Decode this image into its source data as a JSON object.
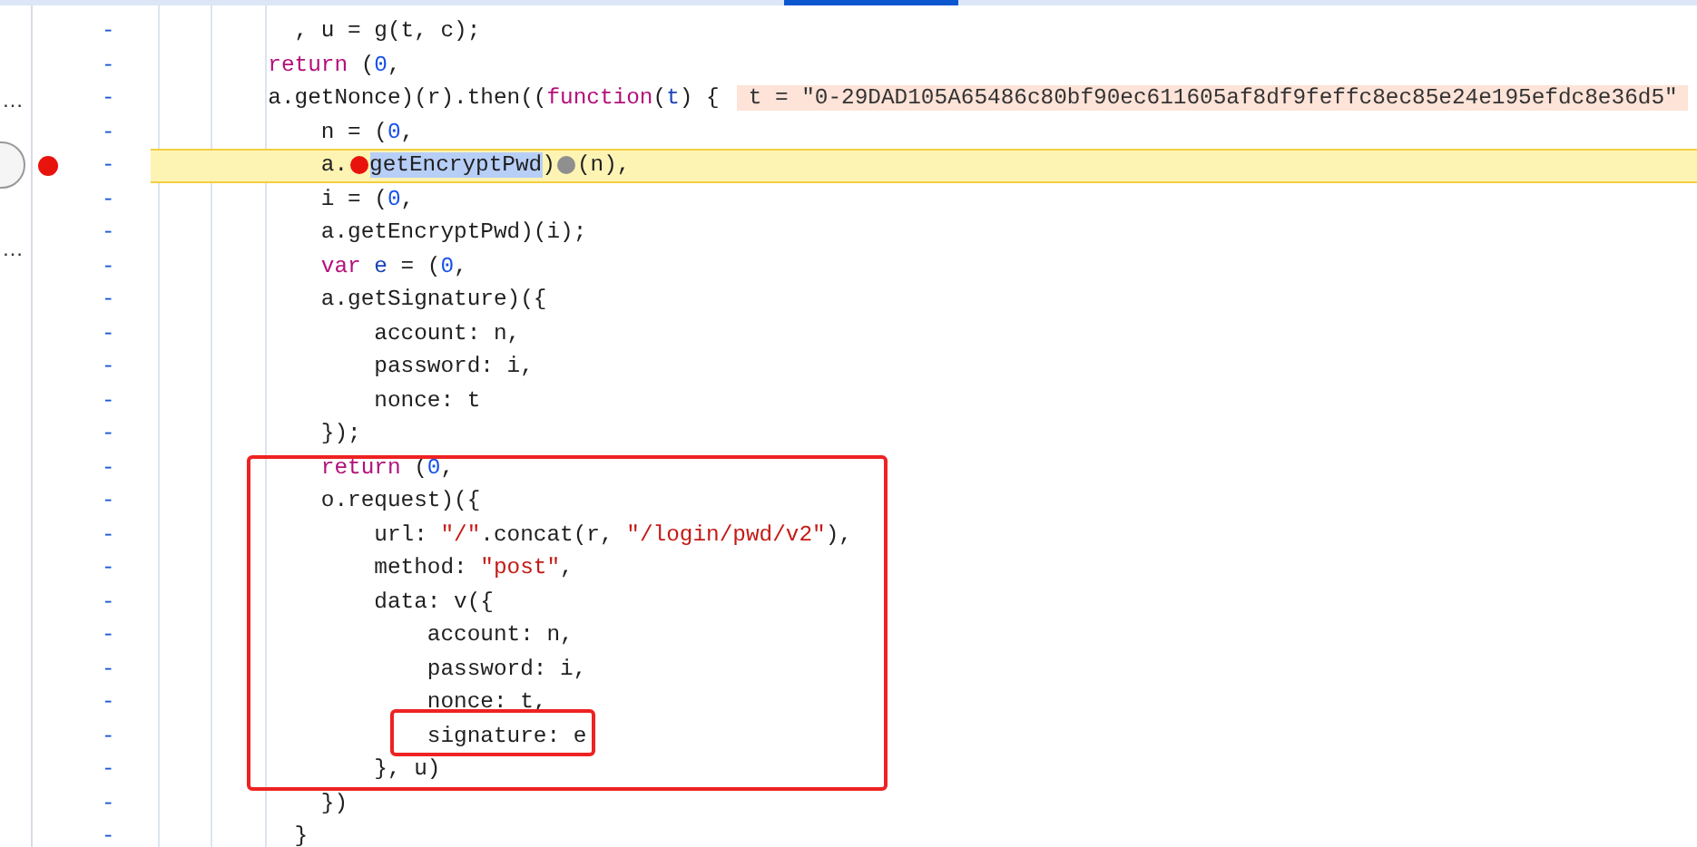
{
  "sidebar": {
    "items": [
      "…",
      "…"
    ]
  },
  "lines": [
    {
      "line_number": "-",
      "breakpoint": false,
      "highlighted": false,
      "tokens": [
        {
          "kind": "plain",
          "text": "    , u = g(t, c);"
        }
      ]
    },
    {
      "line_number": "-",
      "breakpoint": false,
      "highlighted": false,
      "tokens": [
        {
          "kind": "keyword",
          "text": "  return"
        },
        {
          "kind": "plain",
          "text": " ("
        },
        {
          "kind": "number",
          "text": "0"
        },
        {
          "kind": "plain",
          "text": ","
        }
      ]
    },
    {
      "line_number": "-",
      "breakpoint": false,
      "highlighted": false,
      "tokens": [
        {
          "kind": "plain",
          "text": "  a.getNonce)(r).then(("
        },
        {
          "kind": "keyword",
          "text": "function"
        },
        {
          "kind": "plain",
          "text": "("
        },
        {
          "kind": "variable",
          "text": "t"
        },
        {
          "kind": "plain",
          "text": ") {"
        }
      ],
      "inline_value": "t = \"0-29DAD105A65486c80bf90ec611605af8df9feffc8ec85e24e195efdc8e36d5\""
    },
    {
      "line_number": "-",
      "breakpoint": false,
      "highlighted": false,
      "tokens": [
        {
          "kind": "plain",
          "text": "      n = ("
        },
        {
          "kind": "number",
          "text": "0"
        },
        {
          "kind": "plain",
          "text": ","
        }
      ]
    },
    {
      "line_number": "-",
      "breakpoint": true,
      "highlighted": true,
      "tokens": [
        {
          "kind": "plain",
          "text": "      a."
        },
        {
          "kind": "stop"
        },
        {
          "kind": "selected",
          "text": "getEncryptPwd"
        },
        {
          "kind": "plain",
          "text": ")"
        },
        {
          "kind": "pause"
        },
        {
          "kind": "plain",
          "text": "(n),"
        }
      ]
    },
    {
      "line_number": "-",
      "breakpoint": false,
      "highlighted": false,
      "tokens": [
        {
          "kind": "plain",
          "text": "      i = ("
        },
        {
          "kind": "number",
          "text": "0"
        },
        {
          "kind": "plain",
          "text": ","
        }
      ]
    },
    {
      "line_number": "-",
      "breakpoint": false,
      "highlighted": false,
      "tokens": [
        {
          "kind": "plain",
          "text": "      a.getEncryptPwd)(i);"
        }
      ]
    },
    {
      "line_number": "-",
      "breakpoint": false,
      "highlighted": false,
      "tokens": [
        {
          "kind": "keyword",
          "text": "      var "
        },
        {
          "kind": "variable",
          "text": "e"
        },
        {
          "kind": "plain",
          "text": " = ("
        },
        {
          "kind": "number",
          "text": "0"
        },
        {
          "kind": "plain",
          "text": ","
        }
      ]
    },
    {
      "line_number": "-",
      "breakpoint": false,
      "highlighted": false,
      "tokens": [
        {
          "kind": "plain",
          "text": "      a.getSignature)({"
        }
      ]
    },
    {
      "line_number": "-",
      "breakpoint": false,
      "highlighted": false,
      "tokens": [
        {
          "kind": "plain",
          "text": "          account: n,"
        }
      ]
    },
    {
      "line_number": "-",
      "breakpoint": false,
      "highlighted": false,
      "tokens": [
        {
          "kind": "plain",
          "text": "          password: i,"
        }
      ]
    },
    {
      "line_number": "-",
      "breakpoint": false,
      "highlighted": false,
      "tokens": [
        {
          "kind": "plain",
          "text": "          nonce: t"
        }
      ]
    },
    {
      "line_number": "-",
      "breakpoint": false,
      "highlighted": false,
      "tokens": [
        {
          "kind": "plain",
          "text": "      });"
        }
      ]
    },
    {
      "line_number": "-",
      "breakpoint": false,
      "highlighted": false,
      "tokens": [
        {
          "kind": "keyword",
          "text": "      return"
        },
        {
          "kind": "plain",
          "text": " ("
        },
        {
          "kind": "number",
          "text": "0"
        },
        {
          "kind": "plain",
          "text": ","
        }
      ]
    },
    {
      "line_number": "-",
      "breakpoint": false,
      "highlighted": false,
      "tokens": [
        {
          "kind": "plain",
          "text": "      o.request)({"
        }
      ]
    },
    {
      "line_number": "-",
      "breakpoint": false,
      "highlighted": false,
      "tokens": [
        {
          "kind": "plain",
          "text": "          url: "
        },
        {
          "kind": "string",
          "text": "\"/\""
        },
        {
          "kind": "plain",
          "text": ".concat(r, "
        },
        {
          "kind": "string",
          "text": "\"/login/pwd/v2\""
        },
        {
          "kind": "plain",
          "text": "),"
        }
      ]
    },
    {
      "line_number": "-",
      "breakpoint": false,
      "highlighted": false,
      "tokens": [
        {
          "kind": "plain",
          "text": "          method: "
        },
        {
          "kind": "string",
          "text": "\"post\""
        },
        {
          "kind": "plain",
          "text": ","
        }
      ]
    },
    {
      "line_number": "-",
      "breakpoint": false,
      "highlighted": false,
      "tokens": [
        {
          "kind": "plain",
          "text": "          data: v({"
        }
      ]
    },
    {
      "line_number": "-",
      "breakpoint": false,
      "highlighted": false,
      "tokens": [
        {
          "kind": "plain",
          "text": "              account: n,"
        }
      ]
    },
    {
      "line_number": "-",
      "breakpoint": false,
      "highlighted": false,
      "tokens": [
        {
          "kind": "plain",
          "text": "              password: i,"
        }
      ]
    },
    {
      "line_number": "-",
      "breakpoint": false,
      "highlighted": false,
      "tokens": [
        {
          "kind": "plain",
          "text": "              nonce: t,"
        }
      ]
    },
    {
      "line_number": "-",
      "breakpoint": false,
      "highlighted": false,
      "tokens": [
        {
          "kind": "plain",
          "text": "              signature: e"
        }
      ]
    },
    {
      "line_number": "-",
      "breakpoint": false,
      "highlighted": false,
      "tokens": [
        {
          "kind": "plain",
          "text": "          }, u)"
        }
      ]
    },
    {
      "line_number": "-",
      "breakpoint": false,
      "highlighted": false,
      "tokens": [
        {
          "kind": "plain",
          "text": "      })"
        }
      ]
    },
    {
      "line_number": "-",
      "breakpoint": false,
      "highlighted": false,
      "tokens": [
        {
          "kind": "plain",
          "text": "    }"
        }
      ]
    }
  ]
}
